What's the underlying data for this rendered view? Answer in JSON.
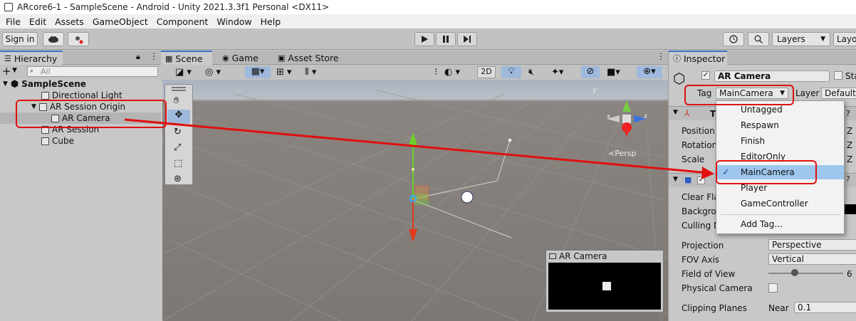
{
  "window": {
    "title": "ARcore6-1 - SampleScene - Android - Unity 2021.3.3f1 Personal <DX11>"
  },
  "menu": [
    "File",
    "Edit",
    "Assets",
    "GameObject",
    "Component",
    "Window",
    "Help"
  ],
  "toolbar": {
    "sign_in": "Sign in",
    "layers": "Layers",
    "layout": "Layo"
  },
  "hierarchy": {
    "tab": "Hierarchy",
    "search_placeholder": "All",
    "items": [
      {
        "label": "SampleScene"
      },
      {
        "label": "Directional Light"
      },
      {
        "label": "AR Session Origin"
      },
      {
        "label": "AR Camera"
      },
      {
        "label": "AR Session"
      },
      {
        "label": "Cube"
      }
    ]
  },
  "scene": {
    "tabs": [
      "Scene",
      "Game",
      "Asset Store"
    ],
    "mode_2d": "2D",
    "persp": "<Persp",
    "camera_preview_title": "AR Camera"
  },
  "inspector": {
    "tab": "Inspector",
    "object_name": "AR Camera",
    "static_label": "Sta",
    "tag_label": "Tag",
    "tag_value": "MainCamera",
    "layer_label": "Layer",
    "layer_value": "Default",
    "transform_header": "T",
    "fields": {
      "position": "Position",
      "rotation": "Rotation",
      "scale": "Scale",
      "clear_flags": "Clear Fla",
      "background": "Backgro",
      "culling": "Culling M",
      "projection": "Projection",
      "projection_value": "Perspective",
      "fov_axis": "FOV Axis",
      "fov_axis_value": "Vertical",
      "field_of_view": "Field of View",
      "fov_value": "6",
      "physical_camera": "Physical Camera",
      "clipping_planes": "Clipping Planes",
      "near_label": "Near",
      "near_value": "0.1",
      "z": "Z"
    }
  },
  "tag_dropdown": {
    "items": [
      "Untagged",
      "Respawn",
      "Finish",
      "EditorOnly",
      "MainCamera",
      "Player",
      "GameController"
    ],
    "selected": "MainCamera",
    "add_tag": "Add Tag..."
  },
  "colors": {
    "annotation_red": "#e01010",
    "selection_blue": "#9fc7ee",
    "tab_accent": "#3a72c4"
  }
}
